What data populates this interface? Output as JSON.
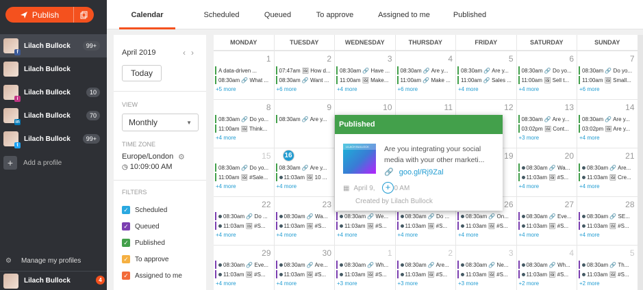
{
  "sidebar": {
    "publish_label": "Publish",
    "profiles": [
      {
        "name": "Lilach Bullock",
        "count": "99+",
        "network": "f",
        "net_color": "#3b5998",
        "selected": true
      },
      {
        "name": "Lilach Bullock",
        "count": "",
        "network": "",
        "net_color": "",
        "selected": false
      },
      {
        "name": "Lilach Bullock",
        "count": "10",
        "network": "i",
        "net_color": "#c13584",
        "selected": false
      },
      {
        "name": "Lilach Bullock",
        "count": "70",
        "network": "in",
        "net_color": "#0077b5",
        "selected": false
      },
      {
        "name": "Lilach Bullock",
        "count": "99+",
        "network": "t",
        "net_color": "#1da1f2",
        "selected": false
      }
    ],
    "add_profile": "Add a profile",
    "manage_profiles": "Manage my profiles",
    "user_name": "Lilach Bullock",
    "notifications": "4"
  },
  "tabs": [
    "Calendar",
    "Scheduled",
    "Queued",
    "To approve",
    "Assigned to me",
    "Published"
  ],
  "active_tab": "Calendar",
  "panel": {
    "month": "April 2019",
    "today_label": "Today",
    "view_label": "VIEW",
    "view_value": "Monthly",
    "tz_label": "TIME ZONE",
    "tz_name": "Europe/London",
    "tz_time": "10:09:00 AM",
    "filters_label": "FILTERS",
    "filters": [
      {
        "label": "Scheduled",
        "color": "#29a8e0"
      },
      {
        "label": "Queued",
        "color": "#7b3fb1"
      },
      {
        "label": "Published",
        "color": "#43a04b"
      },
      {
        "label": "To approve",
        "color": "#f5b042"
      },
      {
        "label": "Assigned to me",
        "color": "#f26b3a"
      }
    ]
  },
  "colors": {
    "accent": "#f4511e",
    "published": "#43a04b",
    "queued": "#7b3fb1",
    "link": "#1f9bd1"
  },
  "calendar": {
    "weekdays": [
      "MONDAY",
      "TUESDAY",
      "WEDNESDAY",
      "THURSDAY",
      "FRIDAY",
      "SATURDAY",
      "SUNDAY"
    ],
    "weeks": [
      [
        {
          "day": "1",
          "posts": [
            {
              "t": "A data-driven ...",
              "k": "pub",
              "icon": "link"
            },
            {
              "t": "08:30am 🔗 What ...",
              "k": "pub"
            }
          ],
          "more": "+5 more"
        },
        {
          "day": "2",
          "posts": [
            {
              "t": "07:47am 🖼 How d...",
              "k": "pub"
            },
            {
              "t": "08:30am 🔗 Want ...",
              "k": "pub"
            }
          ],
          "more": "+6 more"
        },
        {
          "day": "3",
          "posts": [
            {
              "t": "08:30am 🔗 Have ...",
              "k": "pub"
            },
            {
              "t": "11:00am 🖼 Make...",
              "k": "pub"
            }
          ],
          "more": "+4 more"
        },
        {
          "day": "4",
          "posts": [
            {
              "t": "08:30am 🔗 Are y...",
              "k": "pub"
            },
            {
              "t": "11:00am 🔗 Make ...",
              "k": "pub"
            }
          ],
          "more": "+6 more"
        },
        {
          "day": "5",
          "posts": [
            {
              "t": "08:30am 🔗 Are y...",
              "k": "pub"
            },
            {
              "t": "11:00am 🔗 Sales ...",
              "k": "pub"
            }
          ],
          "more": "+4 more"
        },
        {
          "day": "6",
          "posts": [
            {
              "t": "08:30am 🔗 Do yo...",
              "k": "pub"
            },
            {
              "t": "11:00am 🖼 Sell t...",
              "k": "pub"
            }
          ],
          "more": "+4 more"
        },
        {
          "day": "7",
          "posts": [
            {
              "t": "08:30am 🔗 Do yo...",
              "k": "pub"
            },
            {
              "t": "11:00am 🖼 Small...",
              "k": "pub"
            }
          ],
          "more": "+6 more"
        }
      ],
      [
        {
          "day": "8",
          "posts": [
            {
              "t": "08:30am 🔗 Do yo...",
              "k": "pub"
            },
            {
              "t": "11:00am 🖼 Think...",
              "k": "pub"
            }
          ],
          "more": "+4 more"
        },
        {
          "day": "9",
          "posts": [
            {
              "t": "08:30am 🔗 Are y...",
              "k": "pub"
            },
            {
              "t": "",
              "k": "pub"
            }
          ],
          "more": ""
        },
        {
          "day": "10",
          "posts": [],
          "more": ""
        },
        {
          "day": "11",
          "posts": [],
          "more": ""
        },
        {
          "day": "12",
          "posts": [
            {
              "t": "",
              "k": "pub"
            },
            {
              "t": "",
              "k": "pub"
            }
          ],
          "more": ""
        },
        {
          "day": "13",
          "posts": [
            {
              "t": "08:30am 🔗 Are y...",
              "k": "pub"
            },
            {
              "t": "03:02pm 🖼 Cont...",
              "k": "pub"
            }
          ],
          "more": "+3 more"
        },
        {
          "day": "14",
          "posts": [
            {
              "t": "08:30am 🔗 Are y...",
              "k": "pub"
            },
            {
              "t": "03:02pm 🖼 Are y...",
              "k": "pub"
            }
          ],
          "more": "+4 more"
        }
      ],
      [
        {
          "day": "15",
          "dim": true,
          "posts": [
            {
              "t": "08:30am 🔗 Do yo...",
              "k": "pub"
            },
            {
              "t": "11:00am 🖼 #Sale...",
              "k": "pub"
            }
          ],
          "more": "+4 more"
        },
        {
          "day": "16",
          "today": true,
          "posts": [
            {
              "t": "08:30am 🔗 Are y...",
              "k": "pub"
            },
            {
              "t": "11:03am 🖼 10 ...",
              "k": "sched"
            }
          ],
          "more": "+4 more"
        },
        {
          "day": "17",
          "posts": [],
          "more": ""
        },
        {
          "day": "18",
          "posts": [],
          "more": ""
        },
        {
          "day": "19",
          "posts": [
            {
              "t": "",
              "k": "sched"
            },
            {
              "t": "",
              "k": "sched"
            }
          ],
          "more": ""
        },
        {
          "day": "20",
          "posts": [
            {
              "t": "08:30am 🔗 Wa...",
              "k": "sched"
            },
            {
              "t": "11:03am 🖼 #S...",
              "k": "sched"
            }
          ],
          "more": "+4 more"
        },
        {
          "day": "21",
          "posts": [
            {
              "t": "08:30am 🔗 Are...",
              "k": "sched"
            },
            {
              "t": "11:03am 🖼 Cre...",
              "k": "sched"
            }
          ],
          "more": "+4 more"
        }
      ],
      [
        {
          "day": "22",
          "posts": [
            {
              "t": "08:30am 🔗 Do ...",
              "k": "queue"
            },
            {
              "t": "11:03am 🖼 #S...",
              "k": "queue"
            }
          ],
          "more": "+4 more"
        },
        {
          "day": "23",
          "posts": [
            {
              "t": "08:30am 🔗 Wa...",
              "k": "queue"
            },
            {
              "t": "11:03am 🖼 #S...",
              "k": "queue"
            }
          ],
          "more": "+4 more"
        },
        {
          "day": "24",
          "posts": [
            {
              "t": "08:30am 🔗 We...",
              "k": "queue"
            },
            {
              "t": "11:03am 🖼 #S...",
              "k": "queue"
            }
          ],
          "more": "+4 more"
        },
        {
          "day": "25",
          "posts": [
            {
              "t": "08:30am 🔗 Do ...",
              "k": "queue"
            },
            {
              "t": "11:03am 🖼 #S...",
              "k": "queue"
            }
          ],
          "more": "+4 more"
        },
        {
          "day": "26",
          "posts": [
            {
              "t": "08:30am 🔗 On...",
              "k": "queue"
            },
            {
              "t": "11:03am 🖼 #S...",
              "k": "queue"
            }
          ],
          "more": "+4 more"
        },
        {
          "day": "27",
          "posts": [
            {
              "t": "08:30am 🔗 Eve...",
              "k": "queue"
            },
            {
              "t": "11:03am 🖼 #S...",
              "k": "queue"
            }
          ],
          "more": "+4 more"
        },
        {
          "day": "28",
          "posts": [
            {
              "t": "08:30am 🔗 SE...",
              "k": "queue"
            },
            {
              "t": "11:03am 🖼 #S...",
              "k": "queue"
            }
          ],
          "more": "+4 more"
        }
      ],
      [
        {
          "day": "29",
          "posts": [
            {
              "t": "08:30am 🔗 Eve...",
              "k": "queue"
            },
            {
              "t": "11:03am 🖼 #S...",
              "k": "queue"
            }
          ],
          "more": "+4 more"
        },
        {
          "day": "30",
          "posts": [
            {
              "t": "08:30am 🔗 Are...",
              "k": "queue"
            },
            {
              "t": "11:03am 🖼 #S...",
              "k": "queue"
            }
          ],
          "more": "+4 more"
        },
        {
          "day": "1",
          "dim": true,
          "posts": [
            {
              "t": "08:30am 🔗 Wh...",
              "k": "queue"
            },
            {
              "t": "11:03am 🖼 #S...",
              "k": "queue"
            }
          ],
          "more": "+3 more"
        },
        {
          "day": "2",
          "dim": true,
          "posts": [
            {
              "t": "08:30am 🔗 Are...",
              "k": "queue"
            },
            {
              "t": "11:03am 🖼 #S...",
              "k": "queue"
            }
          ],
          "more": "+3 more"
        },
        {
          "day": "3",
          "dim": true,
          "posts": [
            {
              "t": "08:30am 🔗 Ne...",
              "k": "queue"
            },
            {
              "t": "11:03am 🖼 #S...",
              "k": "queue"
            }
          ],
          "more": "+3 more"
        },
        {
          "day": "4",
          "dim": true,
          "posts": [
            {
              "t": "08:30am 🔗 Wh...",
              "k": "queue"
            },
            {
              "t": "11:03am 🖼 #S...",
              "k": "queue"
            }
          ],
          "more": "+2 more"
        },
        {
          "day": "5",
          "dim": true,
          "posts": [
            {
              "t": "08:30am 🔗 Th...",
              "k": "queue"
            },
            {
              "t": "11:03am 🖼 #S...",
              "k": "queue"
            }
          ],
          "more": "+2 more"
        }
      ]
    ]
  },
  "popup": {
    "status": "Published",
    "thumb_text": "LILACH BULLOCK",
    "text": "Are you integrating your social media with your other marketi...",
    "link": "goo.gl/Rj9Zal",
    "date": "April 9, ",
    "time": "8:30 AM",
    "created_by": "Created by Lilach Bullock"
  }
}
